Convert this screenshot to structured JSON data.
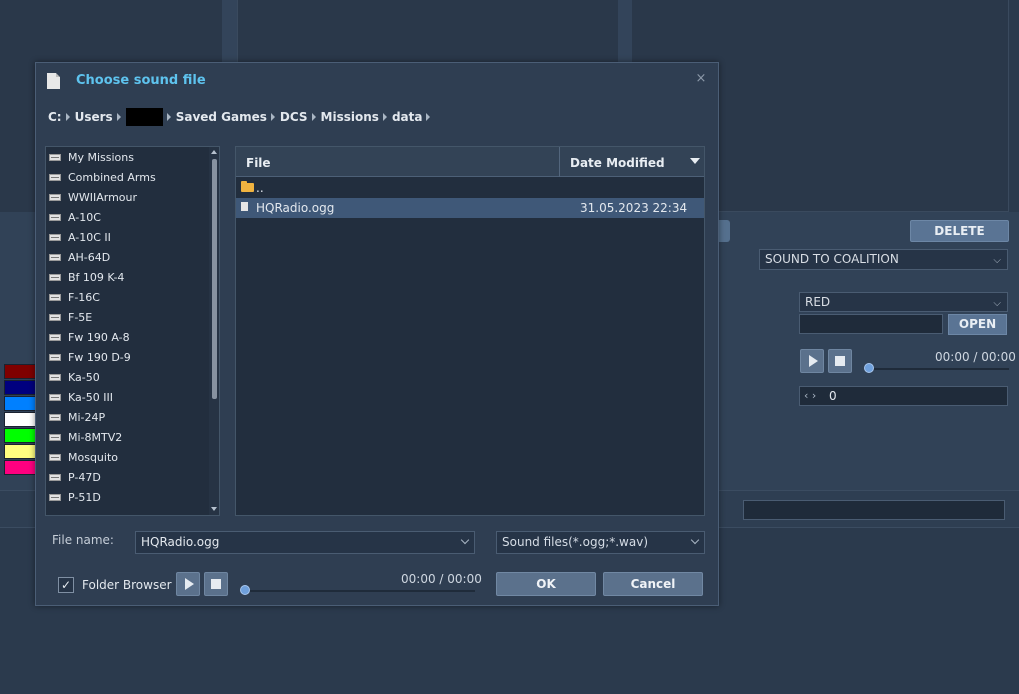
{
  "background": {
    "delete_label": "DELETE",
    "action_select": "SOUND TO COALITION",
    "coalition_select": "RED",
    "open_label": "OPEN",
    "time_text": "00:00 / 00:00",
    "counter_value": "0",
    "swatch_colors": [
      "#7f0000",
      "#00007f",
      "#0080ff",
      "#ffffff",
      "#00ff00",
      "#ffff80",
      "#ff0080"
    ]
  },
  "dialog": {
    "title": "Choose sound file",
    "close_glyph": "×",
    "breadcrumb": [
      "C:",
      "Users",
      "",
      "Saved Games",
      "DCS",
      "Missions",
      "data"
    ],
    "folders": [
      "My Missions",
      "Combined Arms",
      "WWIIArmour",
      "A-10C",
      "A-10C II",
      "AH-64D",
      "Bf 109 K-4",
      "F-16C",
      "F-5E",
      "Fw 190 A-8",
      "Fw 190 D-9",
      "Ka-50",
      "Ka-50 III",
      "Mi-24P",
      "Mi-8MTV2",
      "Mosquito",
      "P-47D",
      "P-51D"
    ],
    "columns": {
      "file": "File",
      "date": "Date Modified"
    },
    "rows": [
      {
        "name": "..",
        "date": "",
        "icon": "folder-icon"
      },
      {
        "name": "HQRadio.ogg",
        "date": "31.05.2023 22:34",
        "icon": "file-icon"
      }
    ],
    "file_name_label": "File name:",
    "file_name_value": "HQRadio.ogg",
    "file_type": "Sound files(*.ogg;*.wav)",
    "folder_browser_label": "Folder Browser",
    "folder_browser_checked": "✓",
    "time_text": "00:00 / 00:00",
    "ok_label": "OK",
    "cancel_label": "Cancel"
  }
}
